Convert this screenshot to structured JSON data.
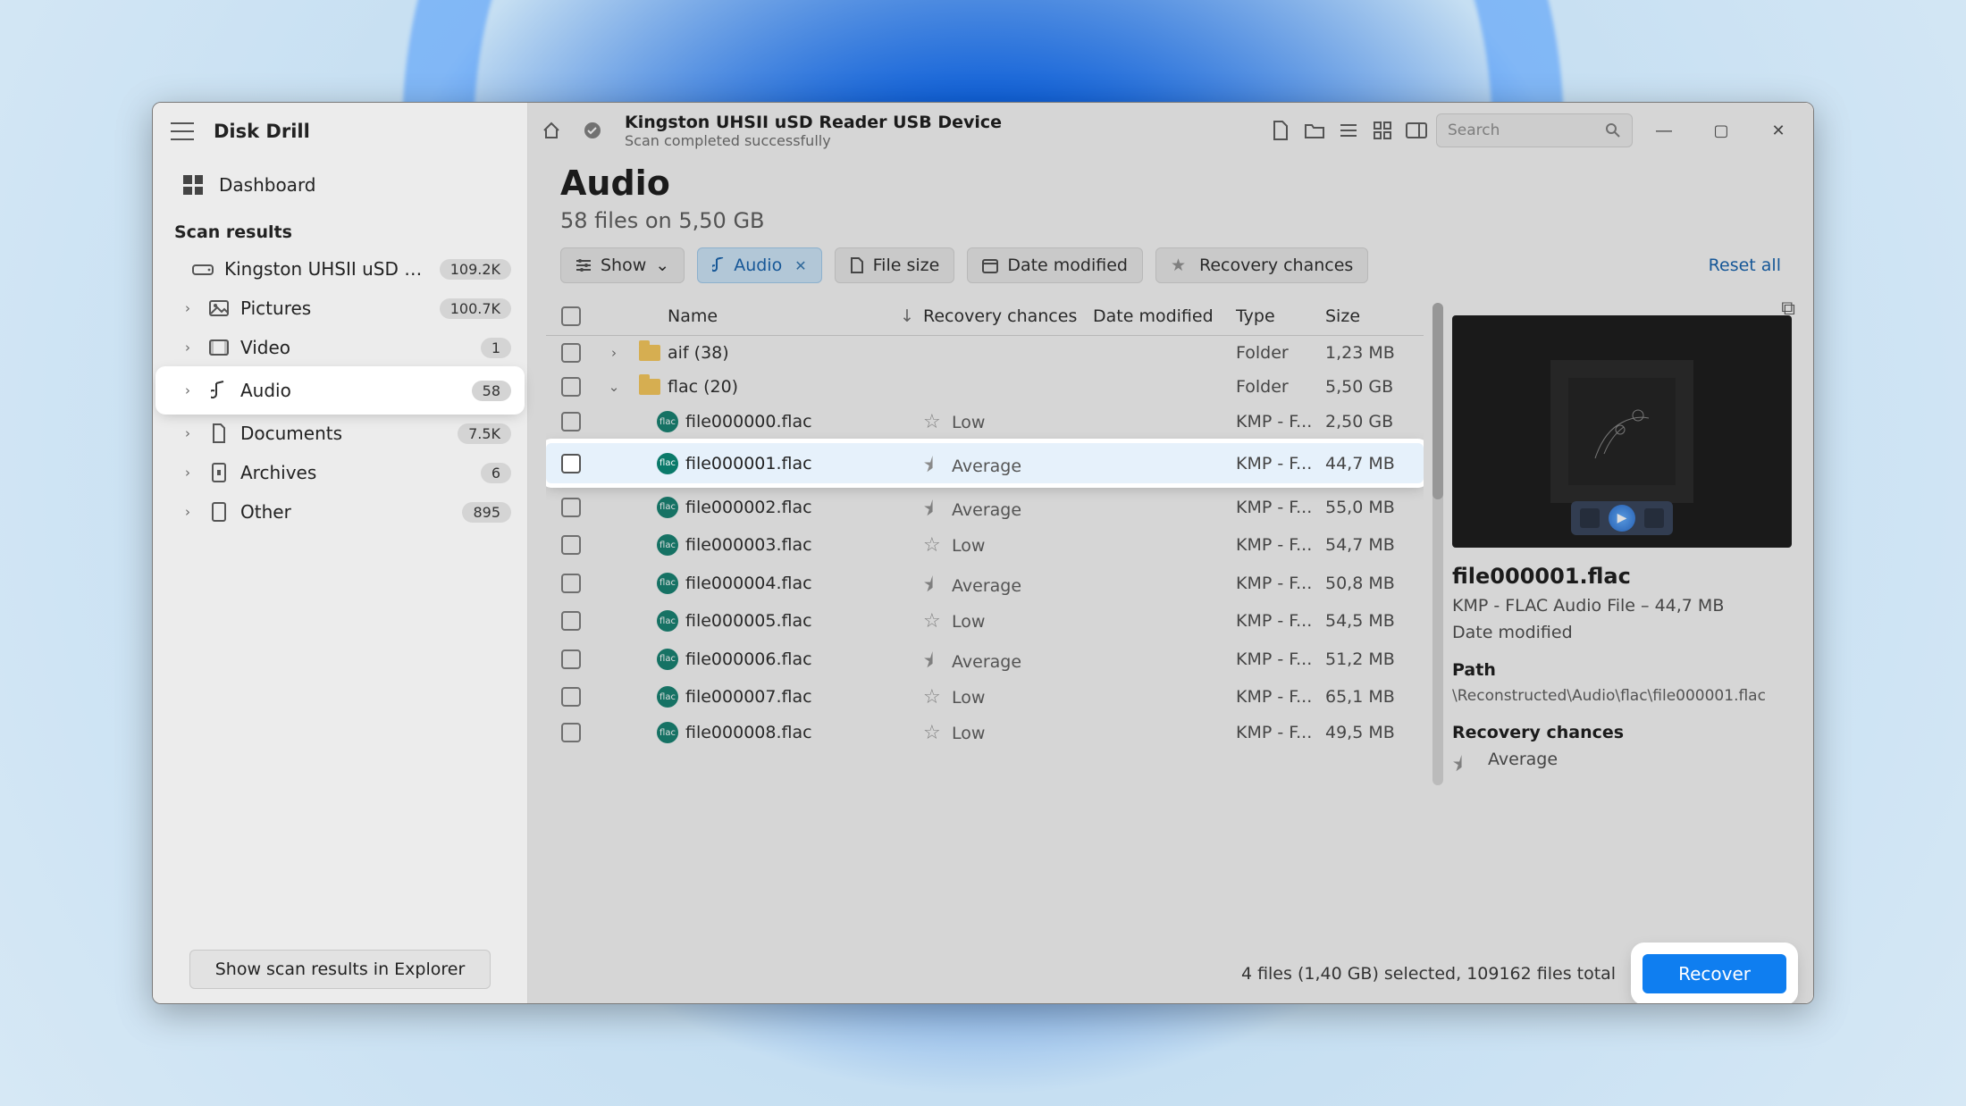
{
  "app": {
    "title": "Disk Drill"
  },
  "sidebar": {
    "dashboard": "Dashboard",
    "section_label": "Scan results",
    "drive": {
      "label": "Kingston UHSII uSD R...",
      "count": "109.2K"
    },
    "items": [
      {
        "label": "Pictures",
        "count": "100.7K"
      },
      {
        "label": "Video",
        "count": "1"
      },
      {
        "label": "Audio",
        "count": "58"
      },
      {
        "label": "Documents",
        "count": "7.5K"
      },
      {
        "label": "Archives",
        "count": "6"
      },
      {
        "label": "Other",
        "count": "895"
      }
    ],
    "footer_button": "Show scan results in Explorer"
  },
  "header": {
    "device": "Kingston UHSII uSD Reader USB Device",
    "status": "Scan completed successfully",
    "search_placeholder": "Search"
  },
  "page": {
    "title": "Audio",
    "subtitle": "58 files on 5,50 GB"
  },
  "chips": {
    "show": "Show",
    "audio": "Audio",
    "file_size": "File size",
    "date_modified": "Date modified",
    "recovery_chances": "Recovery chances",
    "reset": "Reset all"
  },
  "columns": {
    "name": "Name",
    "recovery": "Recovery chances",
    "date": "Date modified",
    "type": "Type",
    "size": "Size"
  },
  "rows": [
    {
      "kind": "folder",
      "expand": "›",
      "name": "aif (38)",
      "type": "Folder",
      "size": "1,23 MB"
    },
    {
      "kind": "folder",
      "expand": "⌄",
      "name": "flac (20)",
      "type": "Folder",
      "size": "5,50 GB"
    },
    {
      "kind": "file",
      "name": "file000000.flac",
      "rc": "Low",
      "type": "KMP - F...",
      "size": "2,50 GB"
    },
    {
      "kind": "file",
      "name": "file000001.flac",
      "rc": "Average",
      "type": "KMP - F...",
      "size": "44,7 MB",
      "selected": true
    },
    {
      "kind": "file",
      "name": "file000002.flac",
      "rc": "Average",
      "type": "KMP - F...",
      "size": "55,0 MB"
    },
    {
      "kind": "file",
      "name": "file000003.flac",
      "rc": "Low",
      "type": "KMP - F...",
      "size": "54,7 MB"
    },
    {
      "kind": "file",
      "name": "file000004.flac",
      "rc": "Average",
      "type": "KMP - F...",
      "size": "50,8 MB"
    },
    {
      "kind": "file",
      "name": "file000005.flac",
      "rc": "Low",
      "type": "KMP - F...",
      "size": "54,5 MB"
    },
    {
      "kind": "file",
      "name": "file000006.flac",
      "rc": "Average",
      "type": "KMP - F...",
      "size": "51,2 MB"
    },
    {
      "kind": "file",
      "name": "file000007.flac",
      "rc": "Low",
      "type": "KMP - F...",
      "size": "65,1 MB"
    },
    {
      "kind": "file",
      "name": "file000008.flac",
      "rc": "Low",
      "type": "KMP - F...",
      "size": "49,5 MB"
    }
  ],
  "preview": {
    "name": "file000001.flac",
    "meta": "KMP - FLAC Audio File – 44,7 MB",
    "date_label": "Date modified",
    "path_label": "Path",
    "path": "\\Reconstructed\\Audio\\flac\\file000001.flac",
    "rc_label": "Recovery chances",
    "rc_value": "Average"
  },
  "footer": {
    "selection": "4 files (1,40 GB) selected, 109162 files total",
    "recover": "Recover"
  }
}
